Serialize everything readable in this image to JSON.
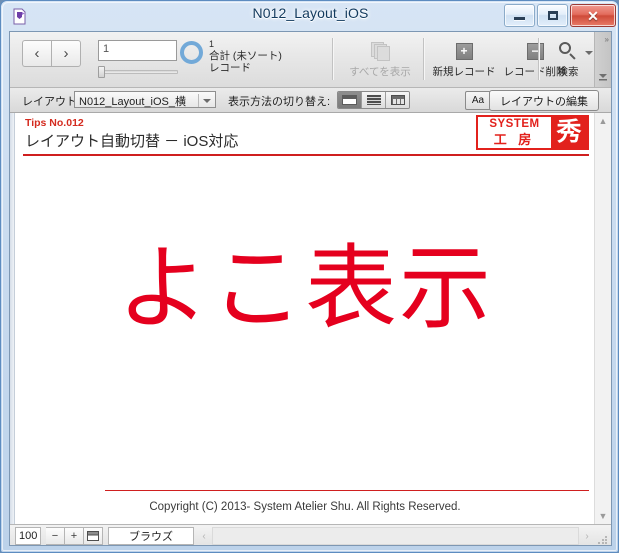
{
  "window": {
    "title": "N012_Layout_iOS",
    "icon": "filemaker-document-icon",
    "minimize_label": "─",
    "maximize_label": "□",
    "close_label": "✕"
  },
  "toolbar": {
    "prev_record_label": "‹",
    "next_record_label": "›",
    "record_number_value": "1",
    "record_count": "1",
    "record_total_label": "合計 (未ソート)",
    "record_unit_label": "レコード",
    "show_all_label": "すべてを表示",
    "new_record_label": "新規レコード",
    "new_record_glyph": "+",
    "delete_record_label": "レコード削除",
    "delete_record_glyph": "−",
    "find_label": "検索",
    "expand_glyph": "»",
    "collapse_glyph": "≡"
  },
  "layoutbar": {
    "layout_label": "レイアウト:",
    "layout_value": "N012_Layout_iOS_横",
    "view_label": "表示方法の切り替え:",
    "view_form": "form-view-icon",
    "view_list": "list-view-icon",
    "view_table": "table-view-icon",
    "text_format_label": "Aa",
    "edit_layout_label": "レイアウトの編集"
  },
  "record": {
    "tips_number": "Tips No.012",
    "title": "レイアウト自動切替 － iOS対応",
    "logo_system": "SYSTEM",
    "logo_kobo": "工 房",
    "logo_shu": "秀",
    "big_text": "よこ表示",
    "copyright": "Copyright (C) 2013- System Atelier Shu. All Rights Reserved."
  },
  "statusbar": {
    "zoom_value": "100",
    "zoom_out_label": "−",
    "zoom_in_label": "+",
    "toggle_statusarea_label": "▤",
    "mode_value": "ブラウズ",
    "scroll_left_glyph": "‹",
    "scroll_right_glyph": "›"
  },
  "colors": {
    "accent_red": "#e2211c",
    "big_text_red": "#e5001e",
    "tips_red": "#d42b1f",
    "frame_blue": "#5d8cc0"
  }
}
